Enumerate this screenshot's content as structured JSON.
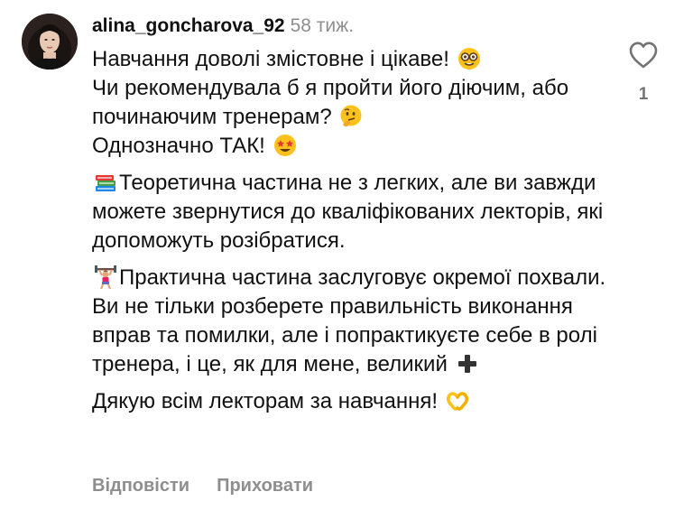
{
  "comment": {
    "username": "alina_goncharova_92",
    "time": "58 тиж.",
    "paragraph1": {
      "line1": "Навчання доволі змістовне і цікаве!",
      "line1_emoji": "nerd-face-icon",
      "line2": "Чи рекомендувала б я пройти його діючим, або починаючим тренерам?",
      "line2_emoji": "thinking-face-icon",
      "line3": "Однозначно ТАК!",
      "line3_emoji": "star-struck-icon"
    },
    "paragraph2": {
      "emoji": "books-icon",
      "text": "Теоретична частина не з легких, але ви завжди можете звернутися до кваліфікованих лекторів, які допоможуть розібратися."
    },
    "paragraph3": {
      "emoji": "weightlifter-icon",
      "text": "Практична частина заслуговує окремої похвали. Ви не тільки розберете правильність виконання вправ та помилки, але і попрактикуєте себе в ролі тренера, і це, як для мене, великий",
      "end_emoji": "plus-icon"
    },
    "paragraph4": {
      "text": "Дякую всім лекторам за навчання!",
      "emoji": "heart-hands-icon"
    }
  },
  "likes": {
    "count": "1",
    "icon": "heart-outline-icon"
  },
  "actions": {
    "reply": "Відповісти",
    "hide": "Приховати"
  },
  "colors": {
    "text": "#111111",
    "muted": "#8e8e8e",
    "icon": "#737373",
    "background": "#ffffff"
  }
}
